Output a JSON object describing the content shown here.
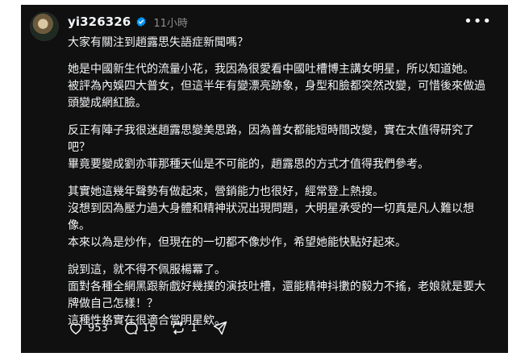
{
  "post": {
    "username": "yi326326",
    "time": "11小時",
    "paragraphs": [
      "大家有關注到趙露思失語症新聞嗎？",
      "她是中國新生代的流量小花，我因為很愛看中國吐槽博主講女明星，所以知道她。\n被評為內娛四大普女，但這半年有變漂亮跡象，身型和臉都突然改變，可惜後來做過頭變成網紅臉。",
      "反正有陣子我很迷趙露思變美思路，因為普女都能短時間改變，實在太值得研究了吧？\n畢竟要變成劉亦菲那種天仙是不可能的，趙露思的方式才值得我們參考。",
      "其實她這幾年聲勢有做起來，營銷能力也很好，經常登上熱搜。\n沒想到因為壓力過大身體和精神狀況出現問題，大明星承受的一切真是凡人難以想像。\n本來以為是炒作，但現在的一切都不像炒作，希望她能快點好起來。",
      "說到這，就不得不佩服楊冪了。\n面對各種全網黑跟新戲好幾撲的演技吐槽，還能精神抖擻的毅力不搖，老娘就是要大牌做自己怎樣！？\n這種性格實在很適合當明星欸。"
    ],
    "stats": {
      "likes": "953",
      "comments": "15",
      "reposts": "1"
    }
  },
  "icons": {
    "verified": "verified-badge-icon",
    "more": "more-options-icon",
    "like": "heart-icon",
    "comment": "comment-icon",
    "repost": "repost-icon",
    "share": "share-icon"
  },
  "colors": {
    "background": "#101010",
    "text": "#f3f5f7",
    "muted": "#8e8e8e",
    "verified": "#0095f6"
  }
}
